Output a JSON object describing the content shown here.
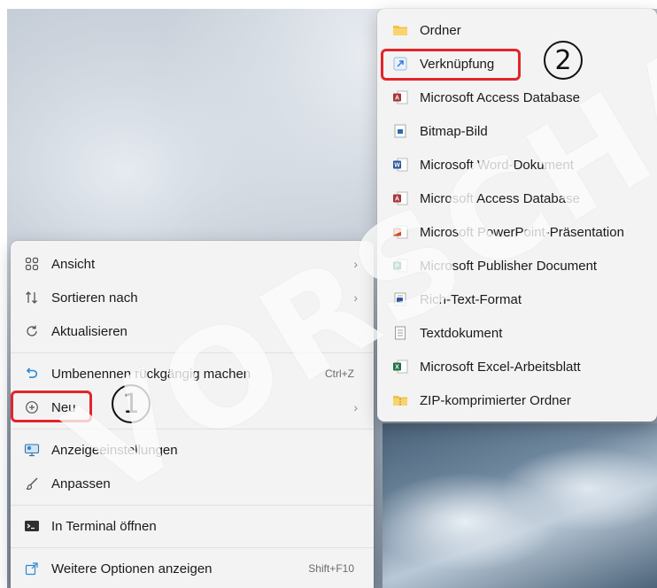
{
  "main_menu": {
    "items": [
      {
        "label": "Ansicht",
        "icon": "grid-icon",
        "has_submenu": true
      },
      {
        "label": "Sortieren nach",
        "icon": "sort-icon",
        "has_submenu": true
      },
      {
        "label": "Aktualisieren",
        "icon": "refresh-icon"
      },
      {
        "label": "Umbenennen rückgängig machen",
        "icon": "undo-icon",
        "shortcut": "Ctrl+Z"
      },
      {
        "label": "Neu",
        "icon": "add-circle-icon",
        "has_submenu": true
      },
      {
        "label": "Anzeigeeinstellungen",
        "icon": "display-settings-icon"
      },
      {
        "label": "Anpassen",
        "icon": "brush-icon"
      },
      {
        "label": "In Terminal öffnen",
        "icon": "terminal-icon"
      },
      {
        "label": "Weitere Optionen anzeigen",
        "icon": "more-options-icon",
        "shortcut": "Shift+F10"
      }
    ]
  },
  "new_submenu": {
    "items": [
      {
        "label": "Ordner",
        "icon": "folder-icon",
        "color": "#f2c14e"
      },
      {
        "label": "Verknüpfung",
        "icon": "shortcut-icon",
        "color": "#2b7cd3"
      },
      {
        "label": "Microsoft Access Database",
        "icon": "access-icon",
        "color": "#a4373a"
      },
      {
        "label": "Bitmap-Bild",
        "icon": "bitmap-icon",
        "color": "#2b6cb0"
      },
      {
        "label": "Microsoft Word-Dokument",
        "icon": "word-icon",
        "color": "#2b579a"
      },
      {
        "label": "Microsoft Access Database",
        "icon": "access-icon",
        "color": "#a4373a"
      },
      {
        "label": "Microsoft PowerPoint-Präsentation",
        "icon": "powerpoint-icon",
        "color": "#d24726"
      },
      {
        "label": "Microsoft Publisher Document",
        "icon": "publisher-icon",
        "color": "#077568"
      },
      {
        "label": "Rich-Text-Format",
        "icon": "rtf-icon",
        "color": "#2b579a"
      },
      {
        "label": "Textdokument",
        "icon": "text-document-icon",
        "color": "#9a9a9a"
      },
      {
        "label": "Microsoft Excel-Arbeitsblatt",
        "icon": "excel-icon",
        "color": "#217346"
      },
      {
        "label": "ZIP-komprimierter Ordner",
        "icon": "zip-folder-icon",
        "color": "#f2c14e"
      }
    ]
  },
  "annotations": {
    "step1": "1",
    "step2": "2"
  },
  "watermark": "VORSCHAU",
  "colors": {
    "highlight": "#e3242b",
    "menu_bg": "#f3f3f3"
  }
}
